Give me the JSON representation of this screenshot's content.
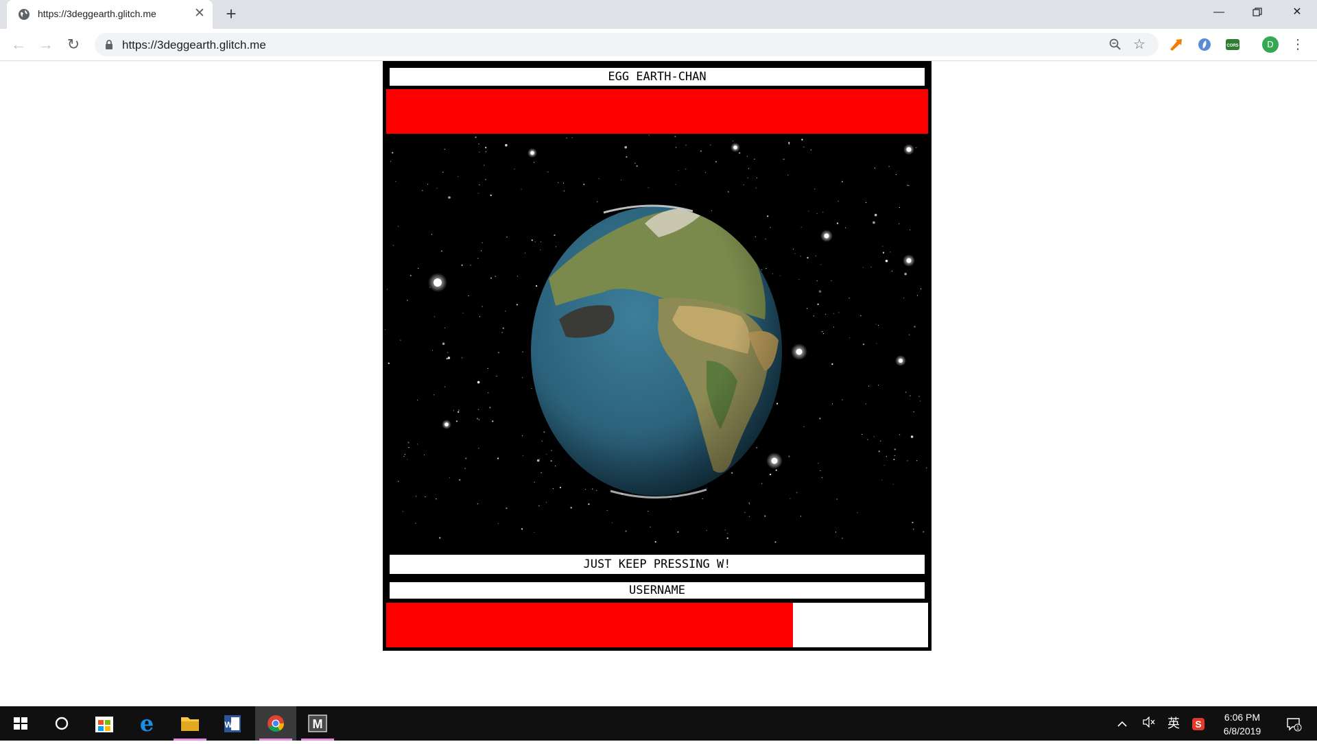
{
  "browser": {
    "tab_title": "https://3deggearth.glitch.me",
    "url": "https://3deggearth.glitch.me",
    "window_controls": [
      "minimize-icon",
      "restore-icon",
      "close-icon"
    ],
    "extensions": [
      {
        "name": "arrow-extension-icon",
        "color": "#f57c00"
      },
      {
        "name": "compass-extension-icon",
        "color": "#5b8bd6"
      },
      {
        "name": "cors-extension-icon",
        "label": "CORS",
        "color": "#2e7d32"
      }
    ],
    "profile_initial": "D"
  },
  "game": {
    "title": "EGG EARTH-CHAN",
    "instruction": "JUST KEEP PRESSING W!",
    "username_label": "USERNAME",
    "bottom_progress": 0.75,
    "colors": {
      "red": "#ff0000",
      "frame": "#000000",
      "label_bg": "#ffffff"
    }
  },
  "taskbar": {
    "apps": [
      "start-icon",
      "cortana-icon",
      "store-icon",
      "edge-icon",
      "file-explorer-icon",
      "word-icon",
      "chrome-icon",
      "malwarebytes-icon"
    ],
    "ime": "英",
    "time": "6:06 PM",
    "date": "6/8/2019",
    "notification_count": "1"
  }
}
